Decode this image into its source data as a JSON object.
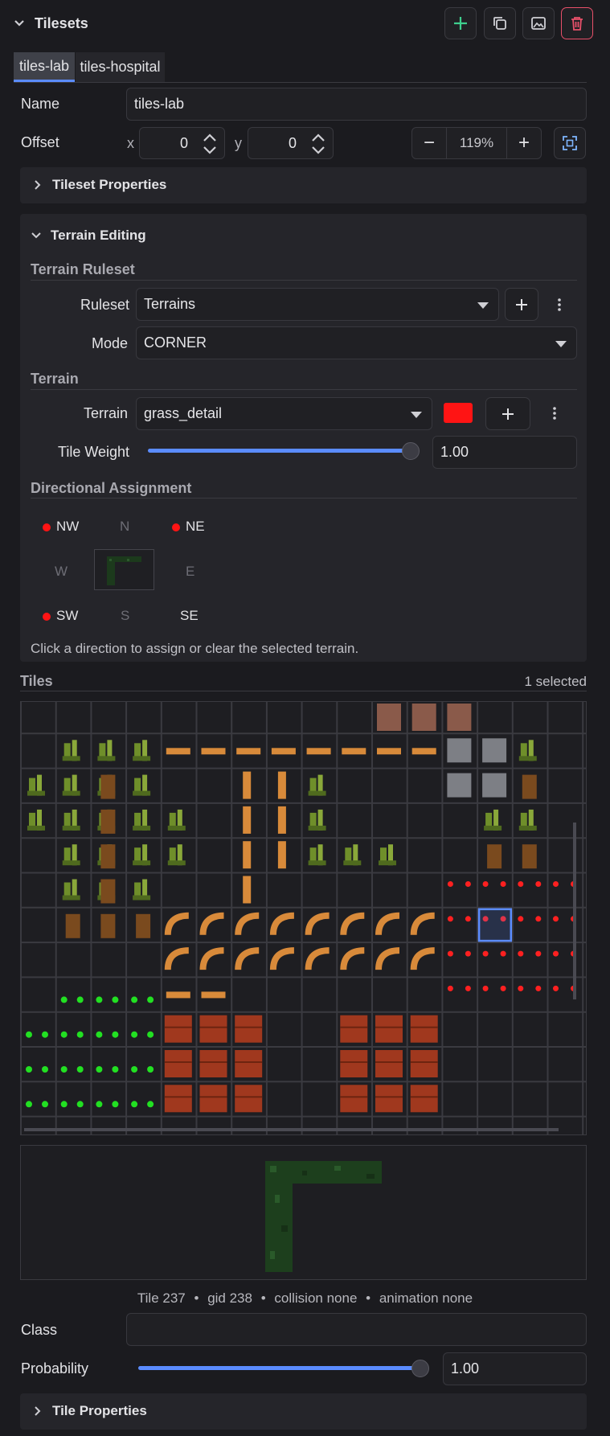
{
  "panel": {
    "title": "Tilesets"
  },
  "toolbar": {
    "add_icon": "plus-icon",
    "duplicate_icon": "copy-icon",
    "image_icon": "image-icon",
    "delete_icon": "trash-icon"
  },
  "tabs": [
    {
      "label": "tiles-lab",
      "active": true
    },
    {
      "label": "tiles-hospital",
      "active": false
    }
  ],
  "name": {
    "label": "Name",
    "value": "tiles-lab"
  },
  "offset": {
    "label": "Offset",
    "x_label": "x",
    "x_value": "0",
    "y_label": "y",
    "y_value": "0"
  },
  "zoom": {
    "minus": "−",
    "value": "119%",
    "plus": "+"
  },
  "tileset_properties": {
    "title": "Tileset Properties"
  },
  "terrain_editing": {
    "title": "Terrain Editing",
    "ruleset_section": "Terrain Ruleset",
    "ruleset_label": "Ruleset",
    "ruleset_value": "Terrains",
    "mode_label": "Mode",
    "mode_value": "CORNER",
    "terrain_section": "Terrain",
    "terrain_label": "Terrain",
    "terrain_value": "grass_detail",
    "terrain_color": "#ff1414",
    "tile_weight_label": "Tile Weight",
    "tile_weight_value": "1.00",
    "tile_weight_fraction": 1.0,
    "directional_section": "Directional Assignment",
    "directions": {
      "nw": "NW",
      "n": "N",
      "ne": "NE",
      "w": "W",
      "e": "E",
      "sw": "SW",
      "s": "S",
      "se": "SE"
    },
    "hint": "Click a direction to assign or clear the selected terrain."
  },
  "tiles": {
    "title": "Tiles",
    "selected_count": "1 selected"
  },
  "tile_info": {
    "tile": "Tile 237",
    "gid": "gid 238",
    "collision": "collision none",
    "animation": "animation none",
    "separator": "•"
  },
  "class": {
    "label": "Class",
    "value": ""
  },
  "probability": {
    "label": "Probability",
    "value": "1.00",
    "fraction": 1.0
  },
  "tile_properties": {
    "title": "Tile Properties"
  },
  "colors": {
    "accent": "#5b8cff",
    "danger": "#e8506a",
    "add_green": "#3ecf8e",
    "terrain_red": "#ff1414"
  }
}
